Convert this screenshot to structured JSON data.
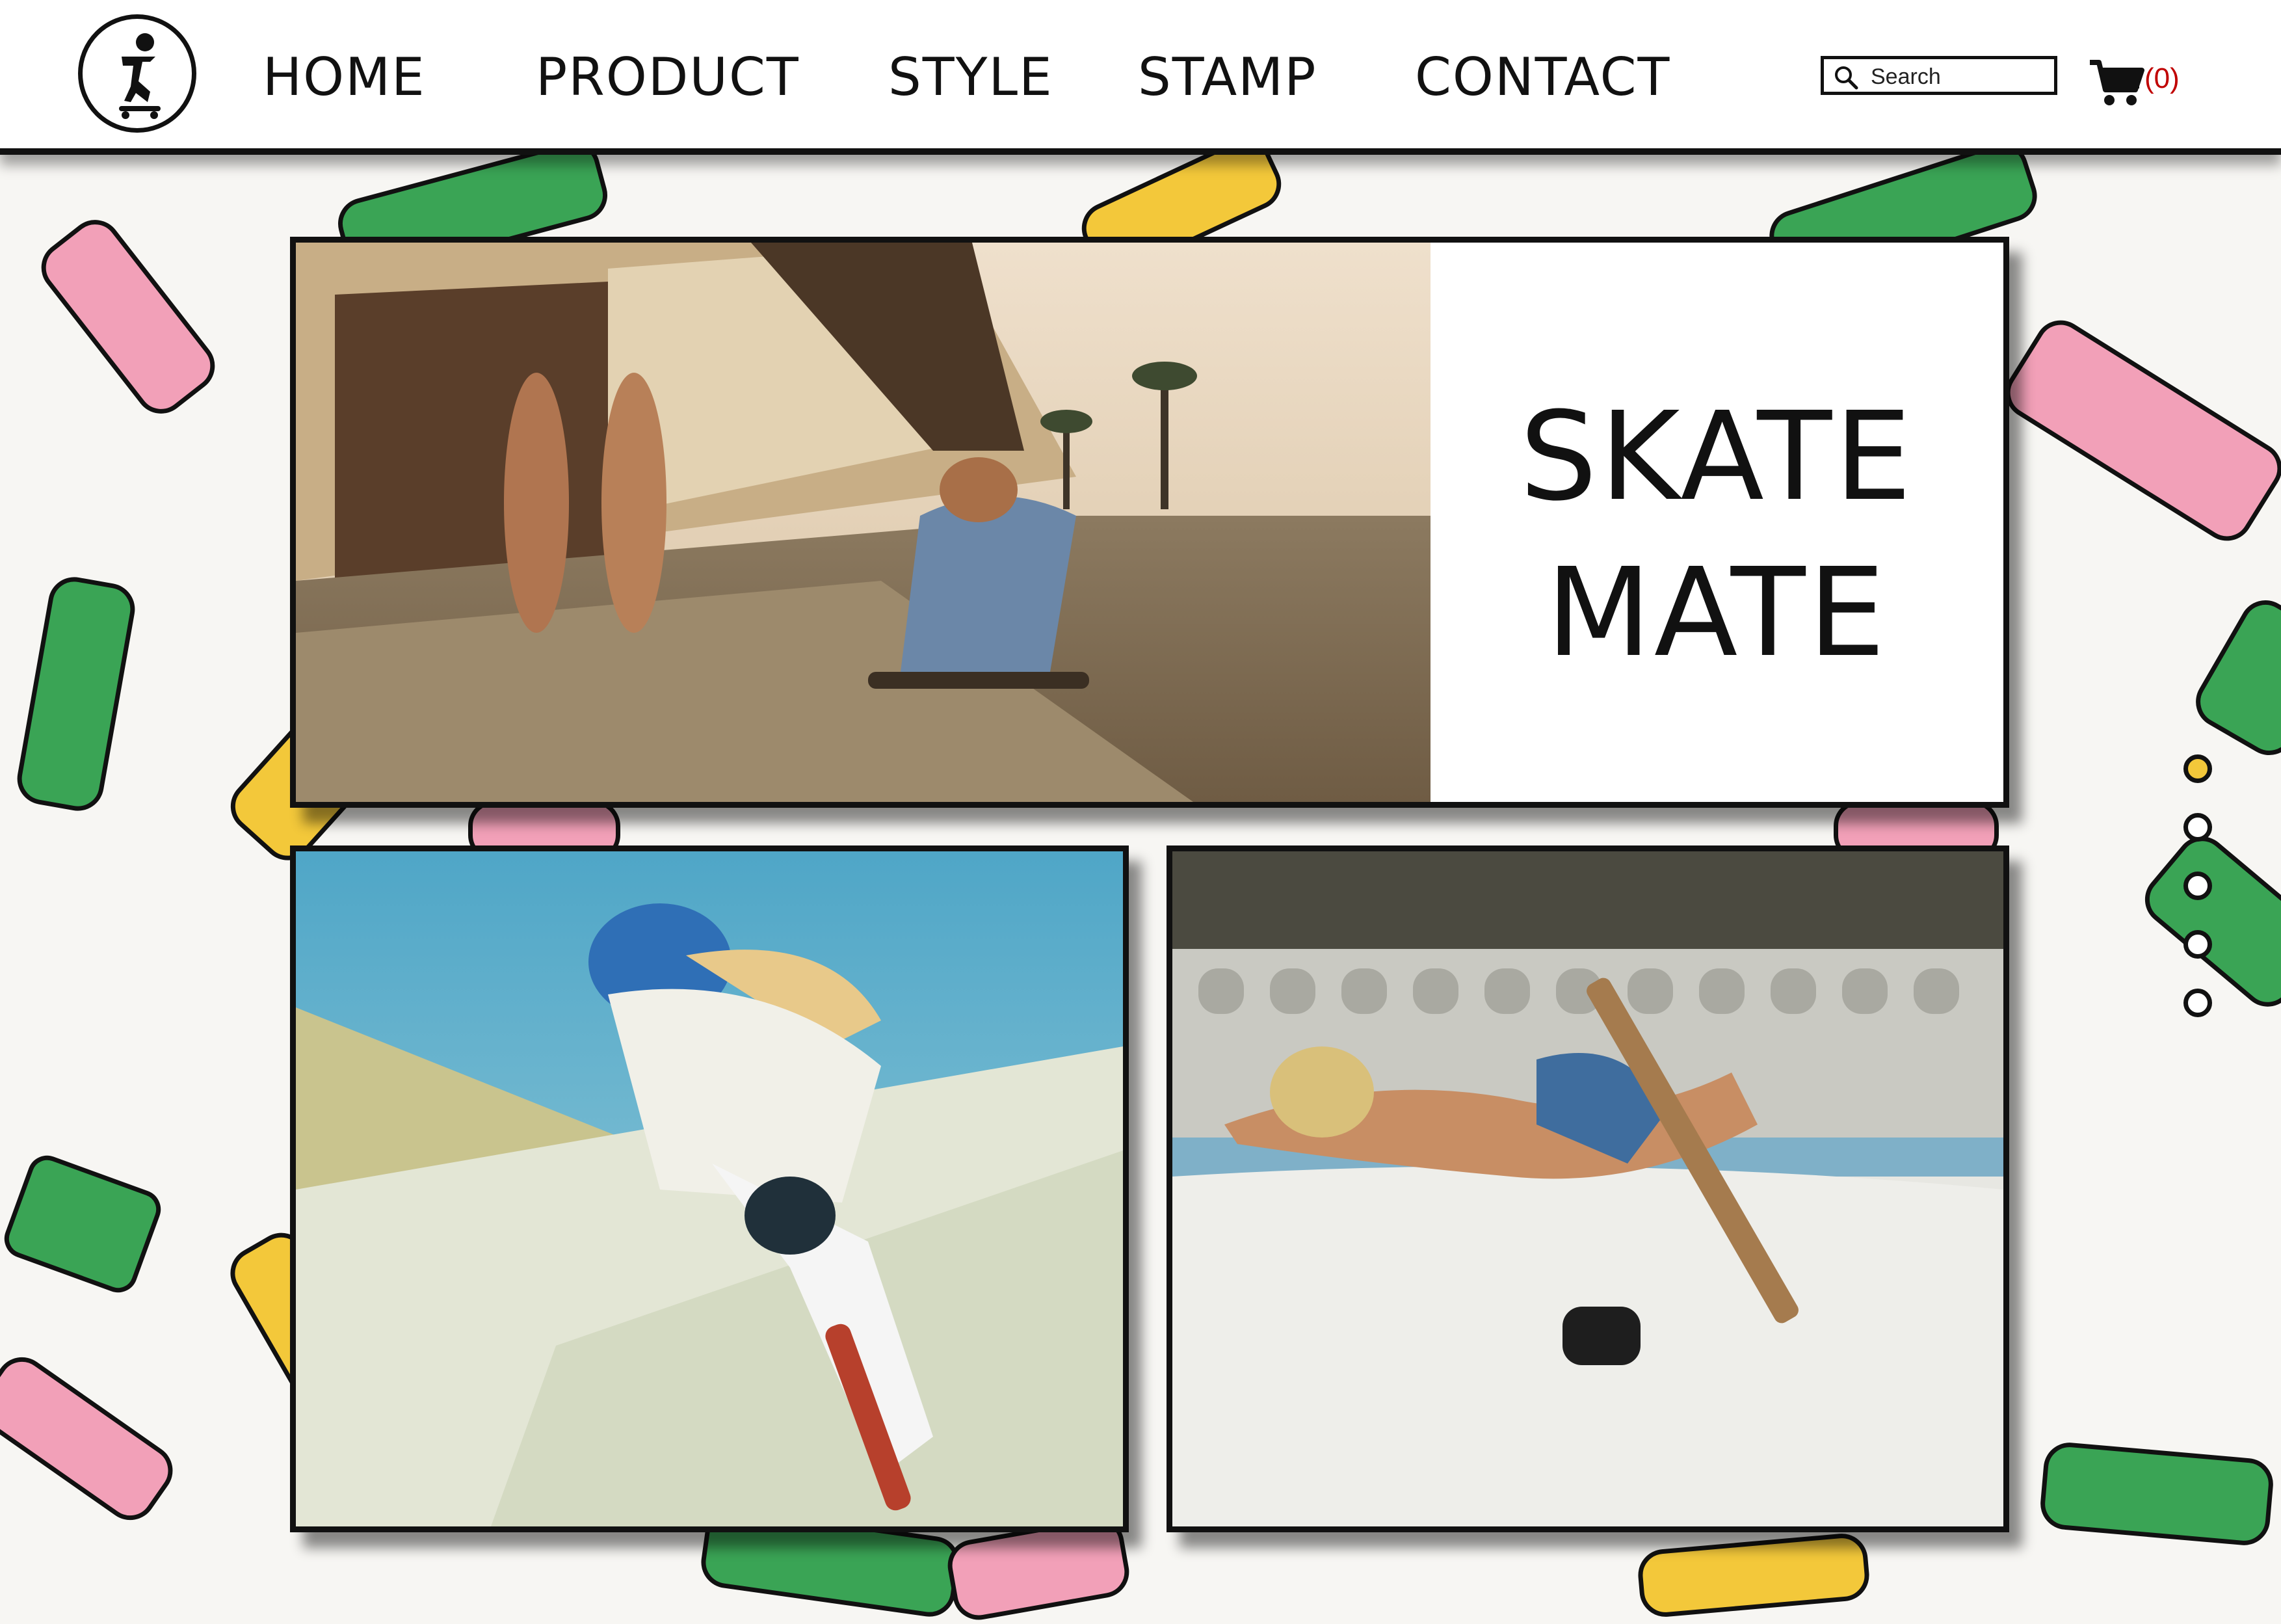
{
  "nav": {
    "items": [
      "HOME",
      "PRODUCT",
      "STYLE",
      "STAMP",
      "CONTACT"
    ]
  },
  "search": {
    "placeholder": "Search"
  },
  "cart": {
    "count": "(0)"
  },
  "hero": {
    "title_line1": "SKATE",
    "title_line2": "MATE"
  },
  "pager": {
    "count": 5,
    "active_index": 0
  },
  "icons": {
    "logo": "skater-logo-icon",
    "search": "search-icon",
    "cart": "cart-icon"
  },
  "colors": {
    "accent_yellow": "#f3c83a",
    "cart_count": "#c00000",
    "board_pink": "#f2a0b8",
    "board_green": "#3aa455",
    "board_yellow": "#f3c83a"
  }
}
